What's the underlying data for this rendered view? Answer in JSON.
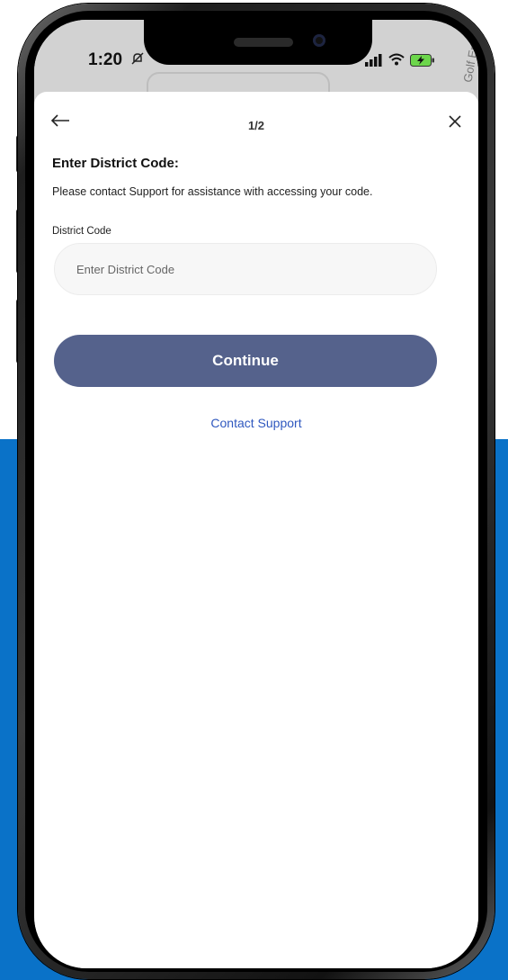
{
  "status_bar": {
    "time": "1:20",
    "icons": [
      "bell-slash-icon",
      "signal-icon",
      "wifi-icon",
      "battery-charging-icon"
    ]
  },
  "map": {
    "street_label": "Golf Enro"
  },
  "header": {
    "step": "1/2",
    "back_icon": "arrow-left-icon",
    "close_icon": "close-icon"
  },
  "form": {
    "title": "Enter District Code:",
    "helper": "Please contact Support for assistance with accessing your code.",
    "field_label": "District Code",
    "input_value": "",
    "input_placeholder": "Enter District Code",
    "continue_label": "Continue",
    "support_link": "Contact Support"
  },
  "colors": {
    "primary_button": "#55628c",
    "link": "#2f58bf",
    "background_blue": "#0a72c8"
  }
}
